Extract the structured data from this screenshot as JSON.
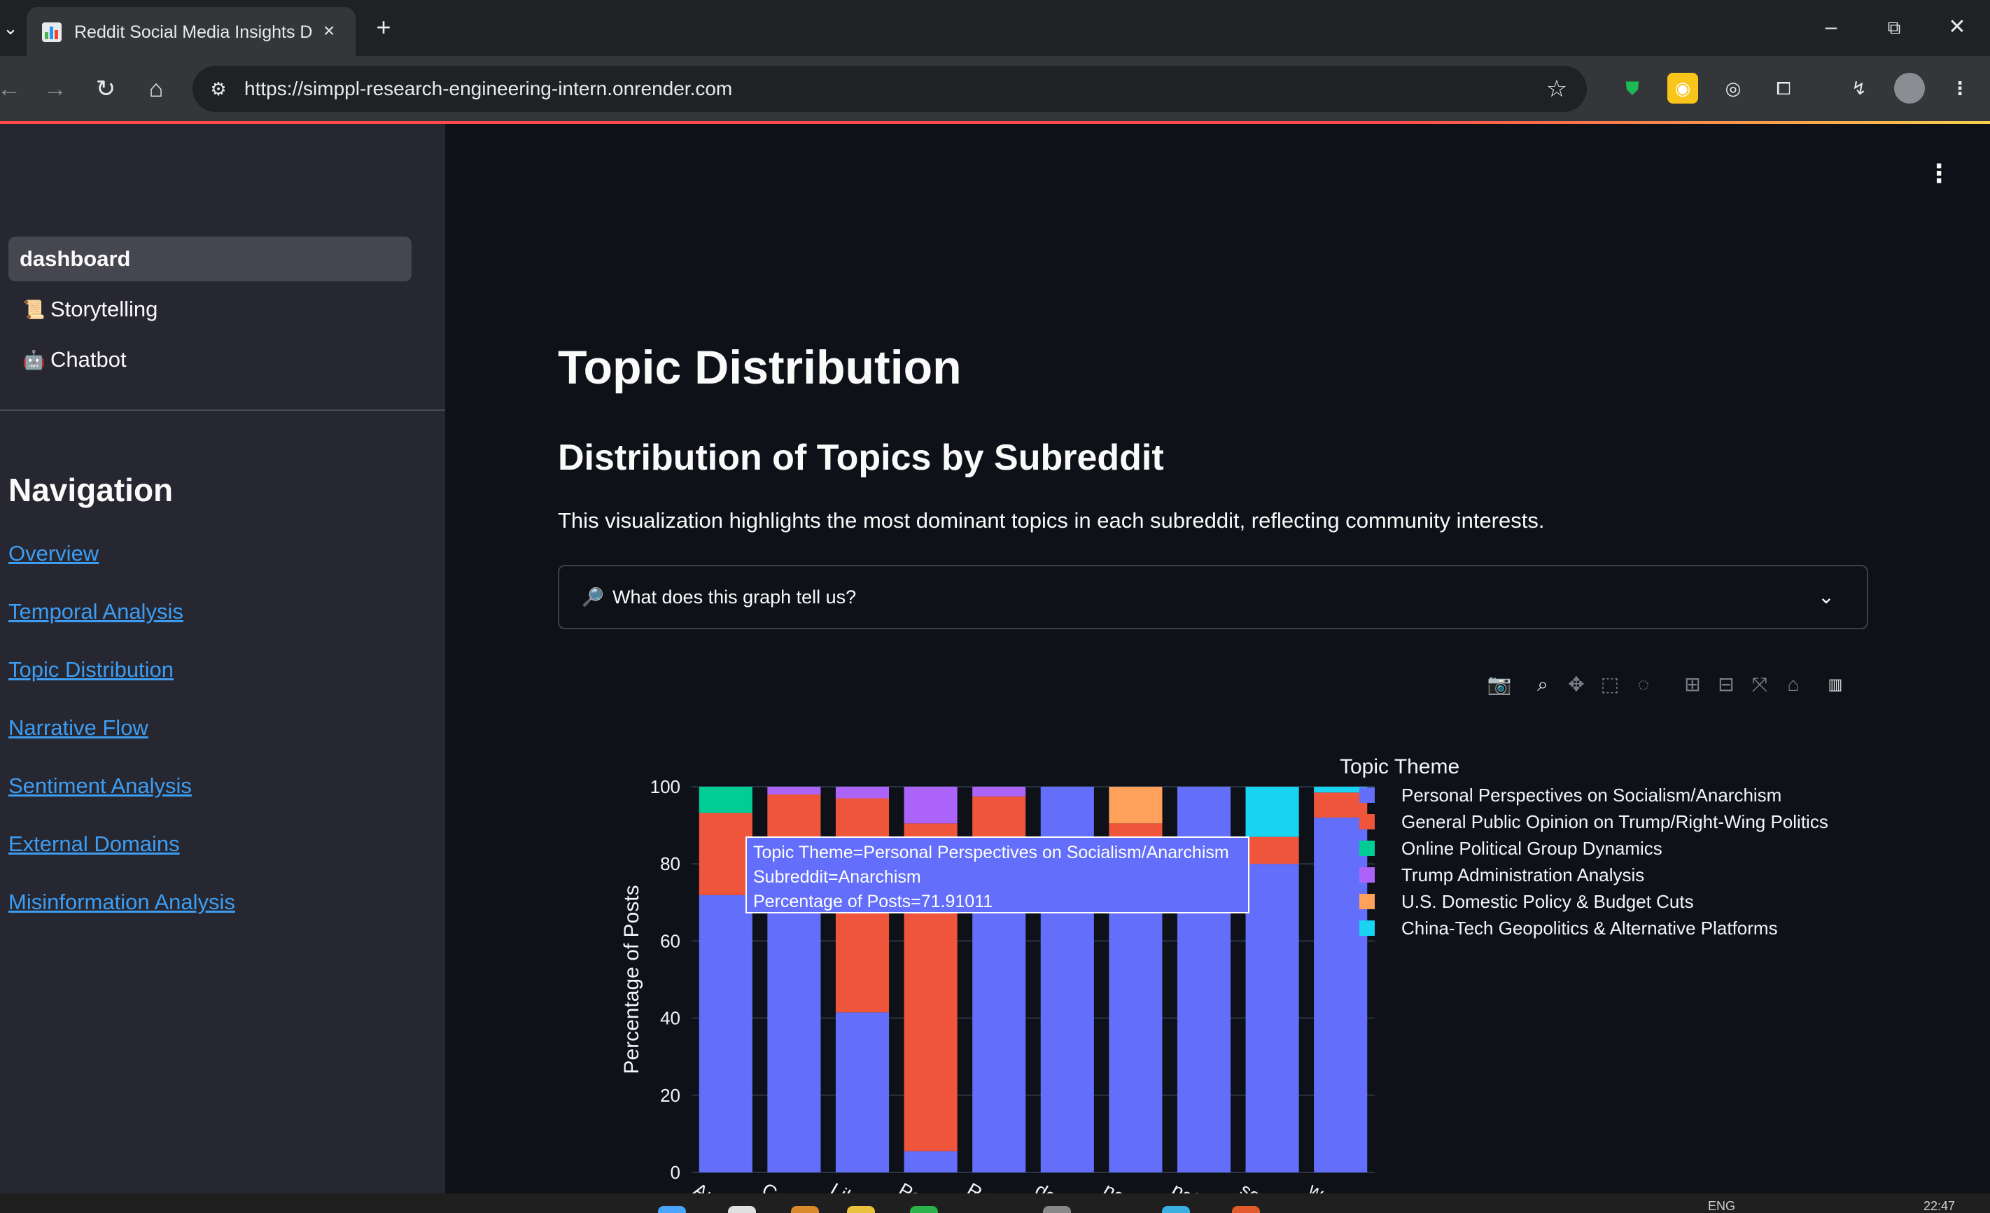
{
  "browser": {
    "tab_title": "Reddit Social Media Insights Da",
    "url": "https://simppl-research-engineering-intern.onrender.com"
  },
  "sidebar": {
    "pages": [
      {
        "label": "dashboard",
        "emoji": "",
        "active": true
      },
      {
        "label": "Storytelling",
        "emoji": "📜",
        "active": false
      },
      {
        "label": "Chatbot",
        "emoji": "🤖",
        "active": false
      }
    ],
    "nav_heading": "Navigation",
    "nav_links": [
      "Overview",
      "Temporal Analysis",
      "Topic Distribution",
      "Narrative Flow",
      "Sentiment Analysis",
      "External Domains",
      "Misinformation Analysis"
    ]
  },
  "main": {
    "title": "Topic Distribution",
    "subtitle": "Distribution of Topics by Subreddit",
    "description": "This visualization highlights the most dominant topics in each subreddit, reflecting community interests.",
    "expander": {
      "label": "What does this graph tell us?",
      "icon": "magnifier-icon"
    }
  },
  "tooltip": {
    "line1": "Topic Theme=Personal Perspectives on Socialism/Anarchism",
    "line2": "Subreddit=Anarchism",
    "line3": "Percentage of Posts=71.91011"
  },
  "taskbar": {
    "lang": "ENG",
    "time": "22:47"
  },
  "chart_data": {
    "type": "bar",
    "stacked": true,
    "ylabel": "Percentage of Posts",
    "xlabel": "",
    "ylim": [
      0,
      100
    ],
    "yticks": [
      0,
      20,
      40,
      60,
      80,
      100
    ],
    "legend_title": "Topic Theme",
    "legend_position": "right",
    "tick_labels": [
      "Anarchis",
      "Conserv",
      "Liberal",
      "PoliticalD",
      "Republic",
      "democra",
      "neoliber",
      "politics",
      "socialism",
      "worldpol"
    ],
    "categories": [
      "Anarchism",
      "Conservative",
      "Liberal",
      "PoliticalDiscussion",
      "Republican",
      "democrats",
      "neoliberal",
      "politics",
      "socialism",
      "worldpolitics"
    ],
    "series": [
      {
        "name": "Personal Perspectives on Socialism/Anarchism",
        "color": "#636efa",
        "values": [
          71.91,
          84.5,
          41.5,
          5.5,
          85.5,
          100,
          85,
          100,
          80,
          92
        ]
      },
      {
        "name": "General Public Opinion on Trump/Right-Wing Politics",
        "color": "#ef553b",
        "values": [
          21.3,
          13.5,
          55.5,
          85,
          12,
          0,
          5.5,
          0,
          7,
          6.5
        ]
      },
      {
        "name": "Online Political Group Dynamics",
        "color": "#00cc96",
        "values": [
          6.79,
          0,
          0,
          0,
          0,
          0,
          0,
          0,
          0,
          0
        ]
      },
      {
        "name": "Trump Administration Analysis",
        "color": "#ab63fa",
        "values": [
          0,
          2,
          3,
          9.5,
          2.5,
          0,
          0,
          0,
          0,
          0
        ]
      },
      {
        "name": "U.S. Domestic Policy & Budget Cuts",
        "color": "#ffa15a",
        "values": [
          0,
          0,
          0,
          0,
          0,
          0,
          9.5,
          0,
          0,
          0
        ]
      },
      {
        "name": "China-Tech Geopolitics & Alternative Platforms",
        "color": "#19d3f3",
        "values": [
          0,
          0,
          0,
          0,
          0,
          0,
          0,
          0,
          13,
          1.5
        ]
      }
    ]
  }
}
